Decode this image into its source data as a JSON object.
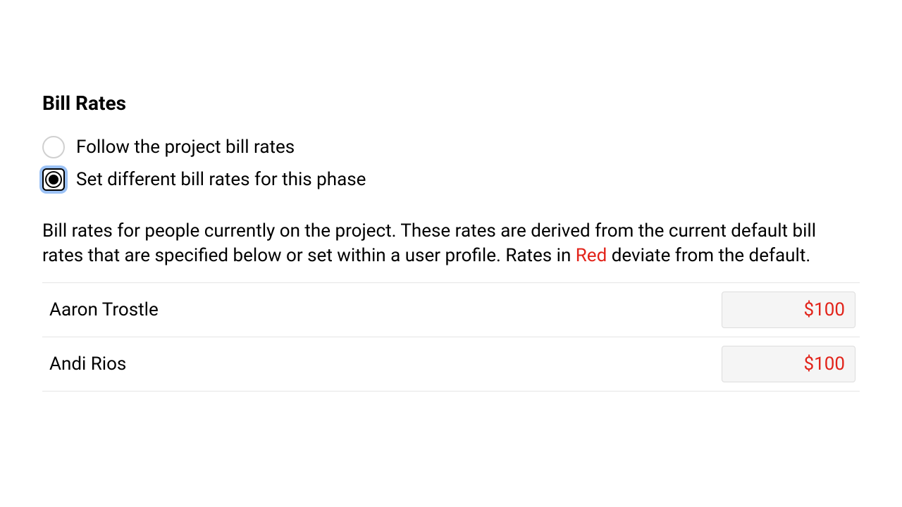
{
  "section": {
    "title": "Bill Rates"
  },
  "radios": {
    "follow": "Follow the project bill rates",
    "set_different": "Set different bill rates for this phase"
  },
  "description": {
    "part1": "Bill rates for people currently on the project. These rates are derived from the current default bill rates that are specified below or set within a user profile. Rates in ",
    "red_word": "Red",
    "part2": " deviate from the default."
  },
  "rows": [
    {
      "name": "Aaron Trostle",
      "rate": "$100"
    },
    {
      "name": "Andi Rios",
      "rate": "$100"
    }
  ]
}
